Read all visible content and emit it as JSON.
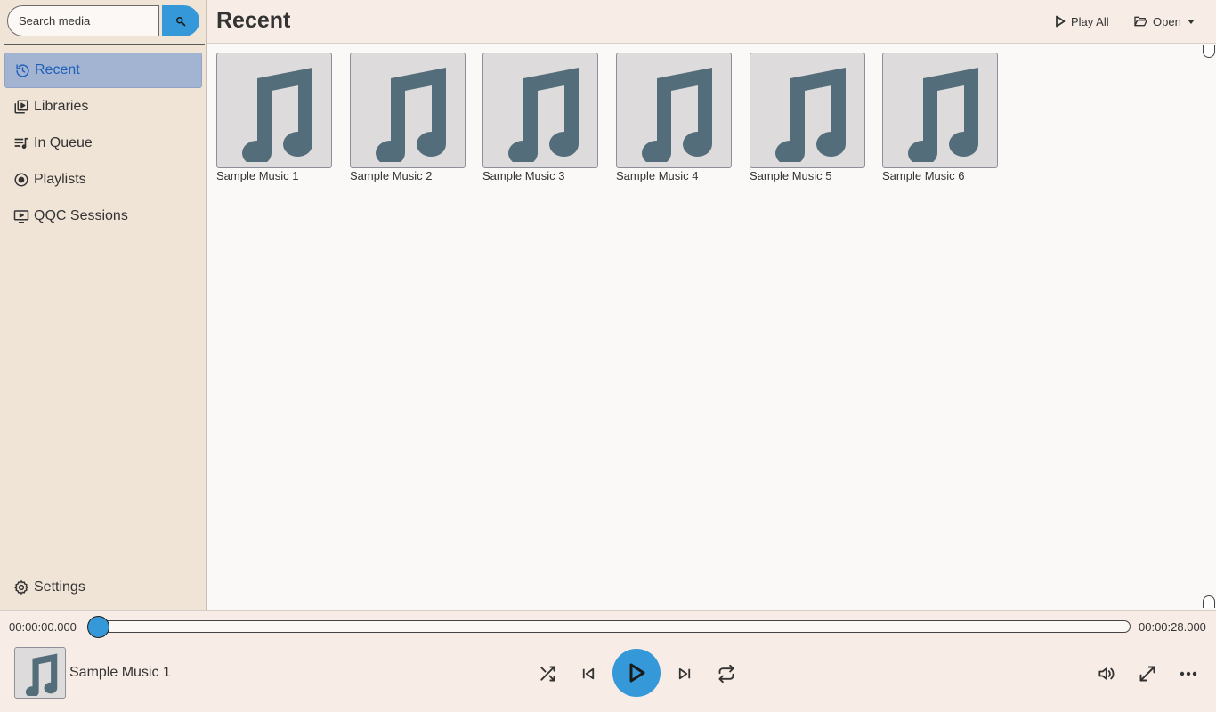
{
  "search": {
    "placeholder": "Search media"
  },
  "sidebar": {
    "items": [
      {
        "label": "Recent",
        "icon": "history-icon",
        "active": true
      },
      {
        "label": "Libraries",
        "icon": "library-icon"
      },
      {
        "label": "In Queue",
        "icon": "queue-music-icon"
      },
      {
        "label": "Playlists",
        "icon": "album-icon"
      },
      {
        "label": "QQC Sessions",
        "icon": "screen-play-icon"
      }
    ],
    "settings_label": "Settings"
  },
  "header": {
    "title": "Recent",
    "play_all_label": "Play All",
    "open_label": "Open"
  },
  "media": [
    {
      "title": "Sample Music 1"
    },
    {
      "title": "Sample Music 2"
    },
    {
      "title": "Sample Music 3"
    },
    {
      "title": "Sample Music 4"
    },
    {
      "title": "Sample Music 5"
    },
    {
      "title": "Sample Music 6"
    }
  ],
  "player": {
    "elapsed": "00:00:00.000",
    "duration": "00:00:28.000",
    "progress": 0,
    "now_playing": "Sample Music 1"
  },
  "colors": {
    "accent": "#3598d8",
    "sidebar_bg": "#f0e4d7",
    "active_item_bg": "#a2b4d2",
    "active_item_text": "#1d5fb8",
    "note_icon": "#546d7a"
  }
}
